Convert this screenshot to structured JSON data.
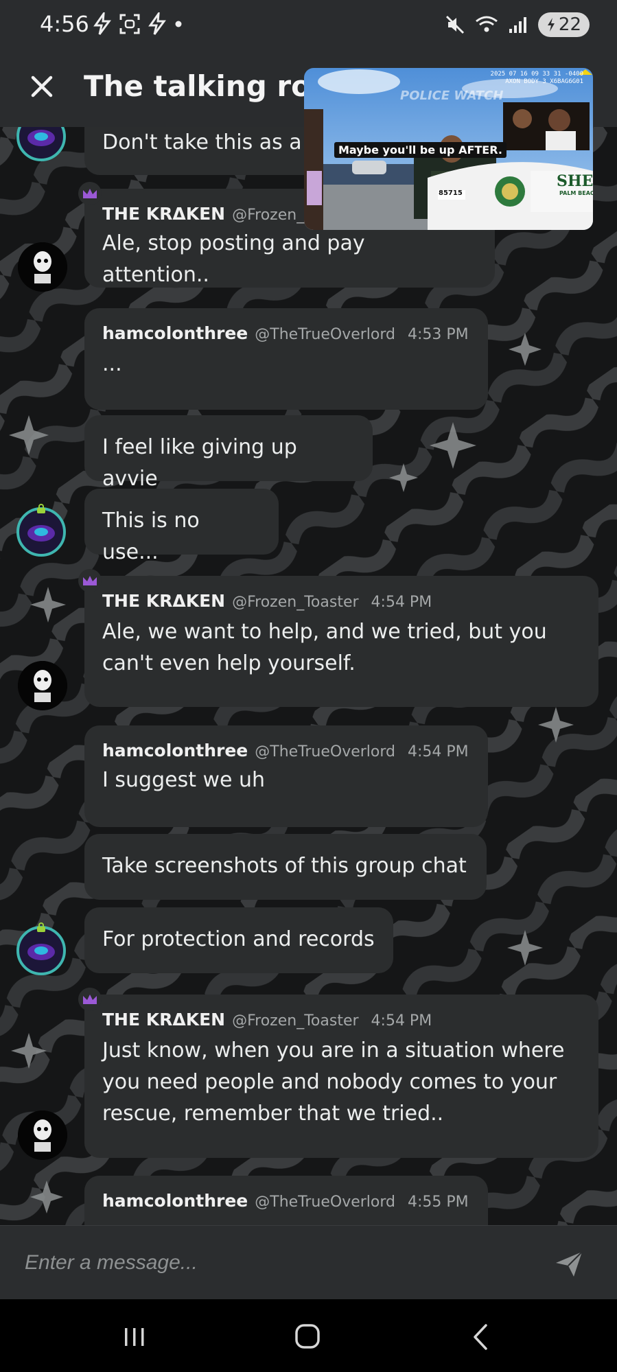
{
  "status": {
    "time": "4:56",
    "battery": "22"
  },
  "header": {
    "title": "The talking room"
  },
  "video": {
    "caption": "Maybe you'll be up AFTER.",
    "watermark": "POLICE WATCH",
    "stamp": "2025 07 16 09 33 31 -0400\nAXON BODY 3 X6BAG6G01",
    "car_text": "SHER",
    "car_subtext": "PALM BEACH",
    "car_number": "85715"
  },
  "messages": [
    {
      "text": "Don't take this as a"
    },
    {
      "author": "THE KRΔKEN",
      "handle": "@Frozen_",
      "text": "Ale, stop posting and pay attention.."
    },
    {
      "author": "hamcolonthree",
      "handle": "@TheTrueOverlord",
      "time": "4:53 PM",
      "text": "..."
    },
    {
      "text": "I feel like giving up avvie"
    },
    {
      "text": "This is no use..."
    },
    {
      "author": "THE KRΔKEN",
      "handle": "@Frozen_Toaster",
      "time": "4:54 PM",
      "text": "Ale, we want to help, and we tried, but you can't even help yourself."
    },
    {
      "author": "hamcolonthree",
      "handle": "@TheTrueOverlord",
      "time": "4:54 PM",
      "text": "I suggest we uh"
    },
    {
      "text": "Take screenshots of this group chat"
    },
    {
      "text": "For protection and records"
    },
    {
      "author": "THE KRΔKEN",
      "handle": "@Frozen_Toaster",
      "time": "4:54 PM",
      "text": "Just know, when you are in a situation where you need people and nobody comes to your rescue, remember that we tried.."
    },
    {
      "author": "hamcolonthree",
      "handle": "@TheTrueOverlord",
      "time": "4:55 PM"
    }
  ],
  "composer": {
    "placeholder": "Enter a message..."
  },
  "icons": {
    "close": "close-icon",
    "send": "send-icon",
    "crown": "crown-icon",
    "nav_recents": "recents-icon",
    "nav_home": "home-icon",
    "nav_back": "back-icon"
  },
  "colors": {
    "bubble": "#2b2d2e",
    "crown": "#9b59d6",
    "avatar_ring": "#3fb6b0"
  }
}
